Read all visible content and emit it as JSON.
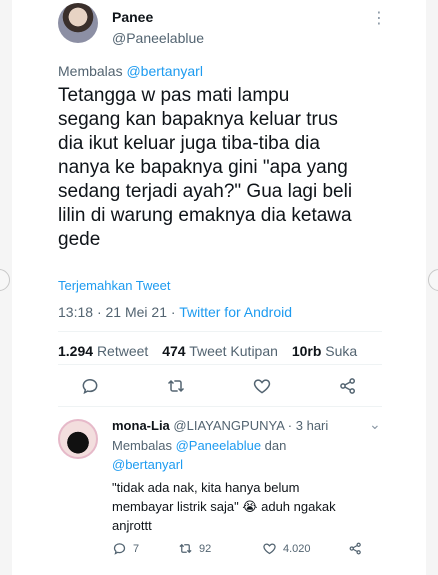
{
  "tweet": {
    "display_name": "Panee",
    "handle": "@Paneelablue",
    "more_icon": "more-dots-icon",
    "reply_prefix": "Membalas ",
    "reply_mention": "@bertanyarl",
    "text_lines": [
      "Tetangga w pas mati lampu",
      "segang kan bapaknya keluar trus",
      "dia ikut keluar juga tiba-tiba dia",
      "nanya ke bapaknya gini \"apa yang",
      "sedang terjadi ayah?\" Gua lagi beli",
      "lilin di warung emaknya dia ketawa",
      "gede"
    ],
    "translate_label": "Terjemahkan Tweet",
    "time": "13:18",
    "date": "21 Mei 21",
    "separator": "·",
    "source": "Twitter for Android",
    "stats": {
      "retweets": "1.294",
      "retweets_label": "Retweet",
      "quotes": "474",
      "quotes_label": "Tweet Kutipan",
      "likes": "10rb",
      "likes_label": "Suka"
    }
  },
  "reply": {
    "display_name": "mona-Lia",
    "handle": "@LIAYANGPUNYA",
    "separator": "·",
    "time": "3 hari",
    "reply_prefix": "Membalas ",
    "mention_1": "@Paneelablue",
    "joiner": " dan",
    "mention_2": "@bertanyarl",
    "text_lines": [
      "\"tidak ada nak, kita hanya belum",
      "membayar listrik saja\" 😭 aduh ngakak",
      "anjrottt"
    ],
    "reply_count": "7",
    "retweet_count": "92",
    "like_count": "4.020"
  },
  "colors": {
    "accent": "#1d9bf0",
    "secondary_text": "#536471",
    "primary_text": "#0f1419"
  }
}
